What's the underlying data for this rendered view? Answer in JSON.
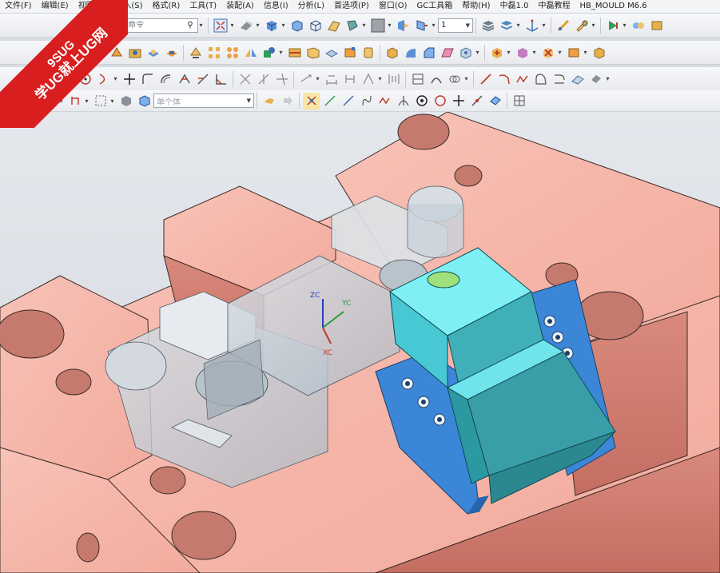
{
  "menubar": {
    "items": [
      "文件(F)",
      "编辑(E)",
      "视图(V)",
      "插入(S)",
      "格式(R)",
      "工具(T)",
      "装配(A)",
      "信息(I)",
      "分析(L)",
      "首选项(P)",
      "窗口(O)",
      "GC工具箱",
      "帮助(H)",
      "中磊1.0",
      "中磊教程",
      "HB_MOULD M6.6"
    ]
  },
  "toolbar1": {
    "search_placeholder": "查找命令",
    "layer_value": "1"
  },
  "toolbar4": {
    "selection_filter": "单个体"
  },
  "watermark": {
    "line1": "9SUG",
    "line2": "学UG就上UG网"
  },
  "axes": {
    "zc": "ZC",
    "yc": "YC",
    "xc": "XC"
  },
  "colors": {
    "mold_plate": "#f4b6aa",
    "slider_cyan": "#5de6ee",
    "wedge_blue": "#3c86d8",
    "glass": "#c9d3dc"
  }
}
